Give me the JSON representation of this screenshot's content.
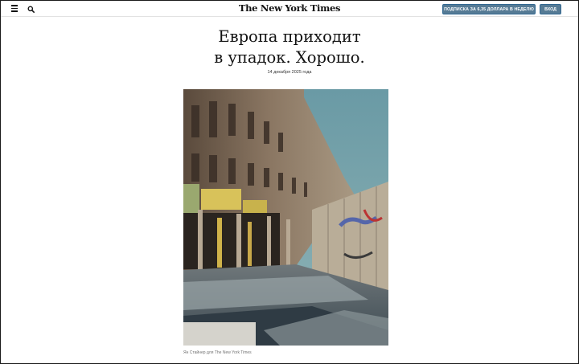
{
  "header": {
    "logo": "The New York Times",
    "subscribe_label": "ПОДПИСКА ЗА 6,35 ДОЛЛАРА В НЕДЕЛЮ",
    "login_label": "ВХОД"
  },
  "article": {
    "headline_line1": "Европа приходит",
    "headline_line2": "в упадок. Хорошо.",
    "date": "14 декабря 2025 года",
    "photo_credit": "Ян Стайнер для The New York Times"
  },
  "icons": {
    "menu": "menu-icon",
    "search": "search-icon"
  },
  "colors": {
    "button_bg": "#567b95",
    "text": "#121212",
    "sky": "#6f9ea8"
  }
}
